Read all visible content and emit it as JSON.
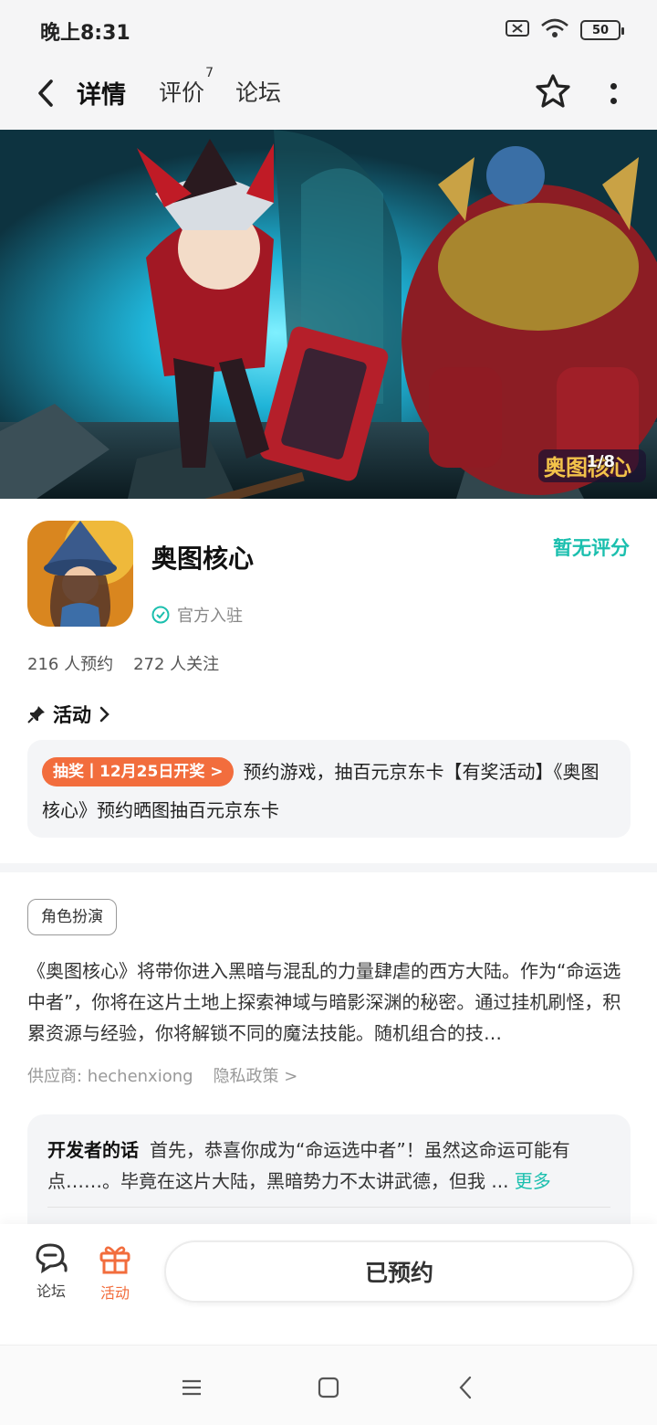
{
  "status_bar": {
    "time": "晚上8:31",
    "battery": "50"
  },
  "nav": {
    "tabs": [
      {
        "label": "详情"
      },
      {
        "label": "评价",
        "badge": "7"
      },
      {
        "label": "论坛"
      }
    ]
  },
  "banner": {
    "counter": "1/8",
    "logo_text": "奥图核心"
  },
  "game": {
    "title": "奥图核心",
    "official": "官方入驻",
    "rating": "暂无评分",
    "reservations": "216 人预约",
    "followers": "272 人关注"
  },
  "activity": {
    "heading": "活动",
    "tag": "抽奖丨12月25日开奖 >",
    "text": "预约游戏，抽百元京东卡【有奖活动】《奥图核心》预约晒图抽百元京东卡"
  },
  "details": {
    "genre": "角色扮演",
    "description": "《奥图核心》将带你进入黑暗与混乱的力量肆虐的西方大陆。作为“命运选中者”，你将在这片土地上探索神域与暗影深渊的秘密。通过挂机刷怪，积累资源与经验，你将解锁不同的魔法技能。随机组合的技…",
    "supplier": "供应商: hechenxiong",
    "privacy": "隐私政策 >"
  },
  "developer": {
    "label": "开发者的话",
    "text": "首先，恭喜你成为“命运选中者”！虽然这命运可能有点……。毕竟在这片大陆，黑暗势力不太讲武德，但我 ...",
    "more": "更多"
  },
  "bottom_bar": {
    "forum_label": "论坛",
    "activity_label": "活动",
    "reserved_button": "已预约"
  },
  "colors": {
    "accent": "#15c8b4",
    "orange": "#f26d3d"
  },
  "icons": [
    "back-chevron-icon",
    "star-icon",
    "more-vertical-icon",
    "verified-icon",
    "pin-icon",
    "chat-icon",
    "gift-icon"
  ]
}
